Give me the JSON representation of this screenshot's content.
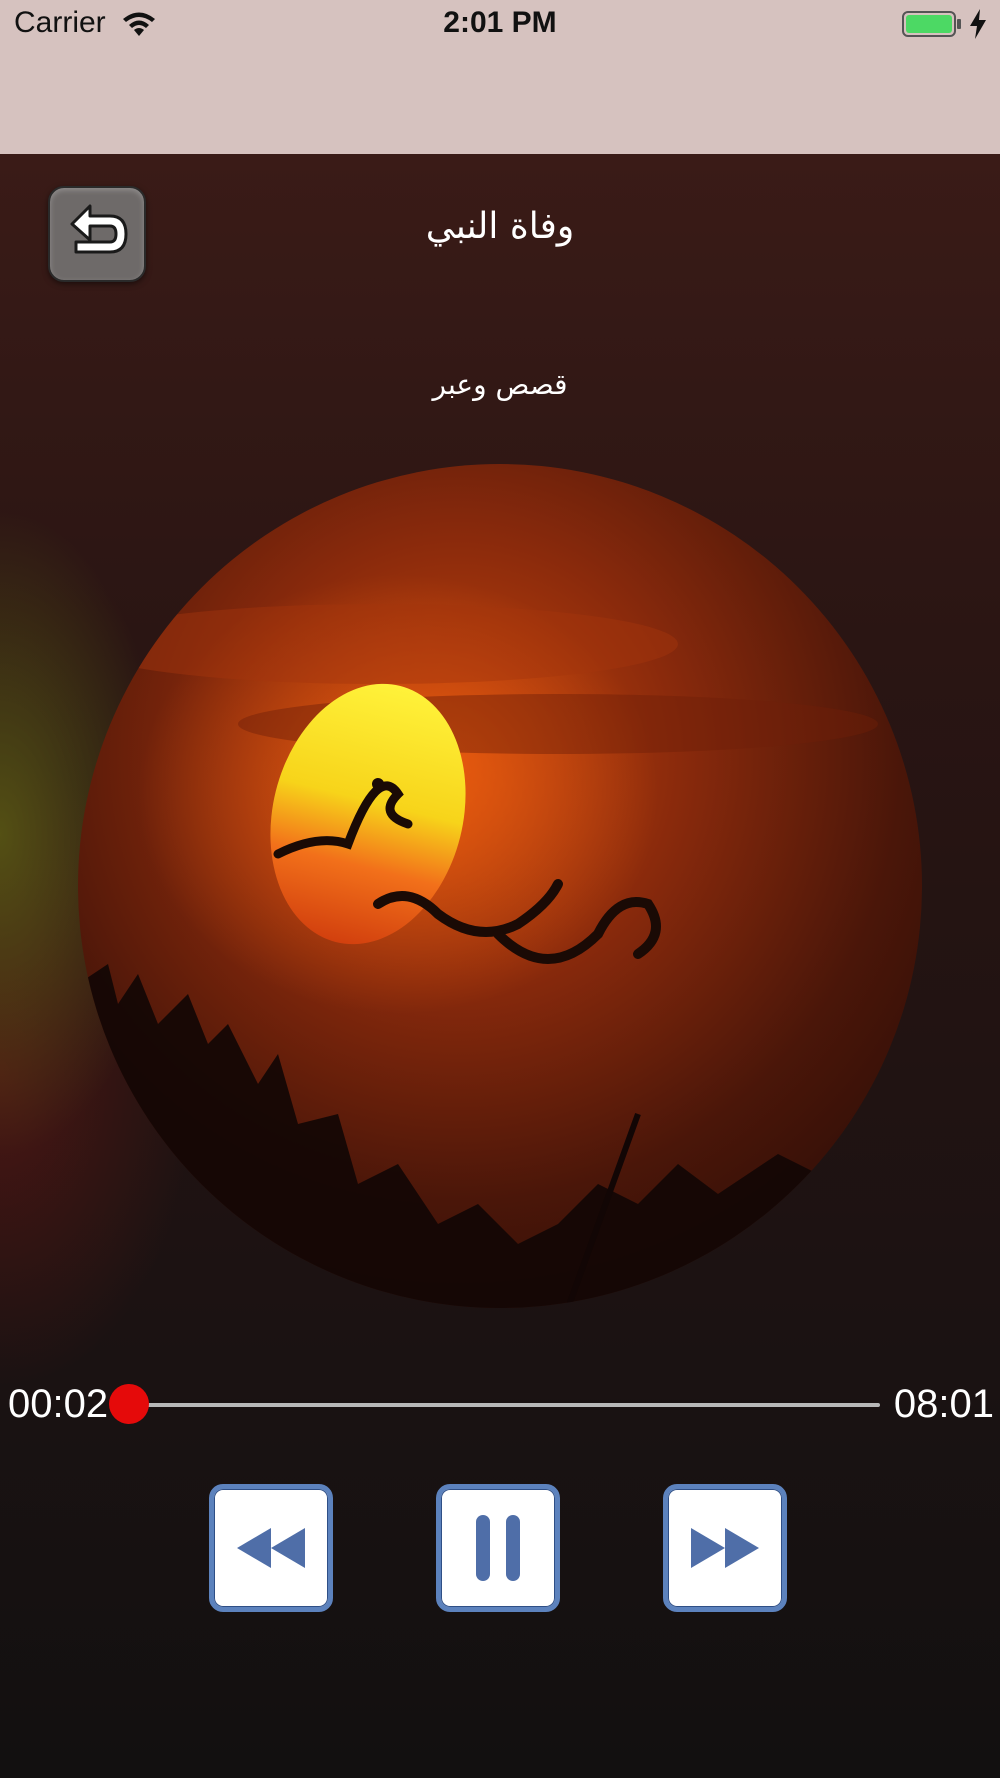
{
  "status_bar": {
    "carrier": "Carrier",
    "time": "2:01 PM",
    "battery_level": 1.0,
    "charging": true,
    "wifi_icon": "wifi-icon",
    "battery_icon": "battery-icon",
    "charging_icon": "lightning-icon"
  },
  "header": {
    "back_icon": "back-arrow-icon",
    "title": "وفاة النبي",
    "subtitle": "قصص وعبر"
  },
  "artwork": {
    "description_icon": "album-artwork",
    "calligraphy_text": "قصص و عبر"
  },
  "player": {
    "current_time": "00:02",
    "total_time": "08:01",
    "progress": 0.004,
    "accent_color": "#e50a0a",
    "controls": [
      {
        "name": "rewind",
        "icon": "rewind-icon"
      },
      {
        "name": "pause",
        "icon": "pause-icon"
      },
      {
        "name": "forward",
        "icon": "fast-forward-icon"
      }
    ]
  }
}
